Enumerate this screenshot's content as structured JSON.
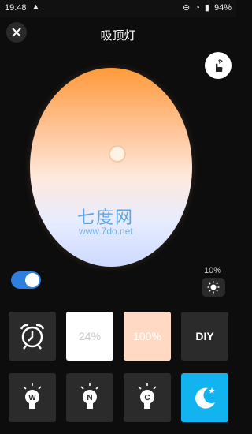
{
  "status": {
    "time": "19:48",
    "battery": "94%"
  },
  "header": {
    "title": "吸顶灯"
  },
  "watermark": {
    "brand": "七度网",
    "url": "www.7do.net"
  },
  "controls": {
    "brightness_label": "10%",
    "power_on": true
  },
  "presets": {
    "row1": [
      {
        "name": "alarm",
        "type": "icon",
        "icon": "alarm-clock-icon"
      },
      {
        "name": "white-24",
        "type": "text",
        "label": "24%"
      },
      {
        "name": "warm-100",
        "type": "text",
        "label": "100%"
      },
      {
        "name": "diy",
        "type": "text",
        "label": "DIY"
      }
    ],
    "row2": [
      {
        "name": "warm-bulb",
        "type": "icon",
        "icon": "bulb-w-icon",
        "letter": "W"
      },
      {
        "name": "neutral-bulb",
        "type": "icon",
        "icon": "bulb-n-icon",
        "letter": "N"
      },
      {
        "name": "cool-bulb",
        "type": "icon",
        "icon": "bulb-c-icon",
        "letter": "C"
      },
      {
        "name": "night-mode",
        "type": "icon",
        "icon": "moon-icon"
      }
    ]
  },
  "colors": {
    "accent": "#2f7fe0",
    "night_tile": "#11b4ef",
    "wheel_warm": "#ff9a3a",
    "wheel_cool": "#cdd9ff"
  }
}
